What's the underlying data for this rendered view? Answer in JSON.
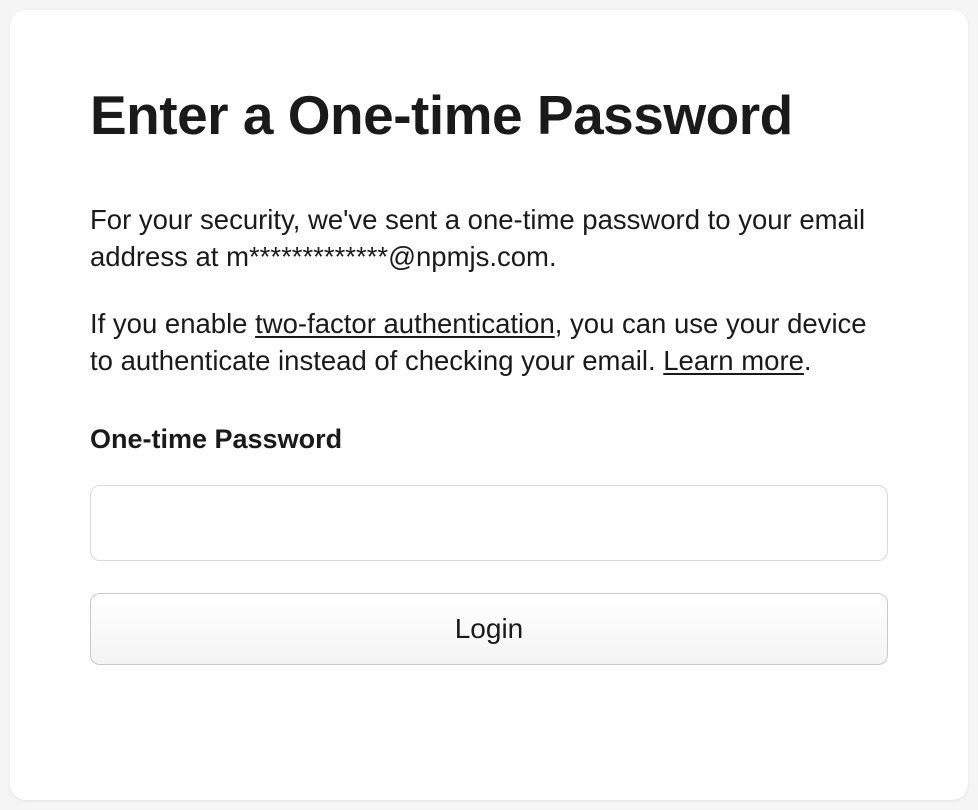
{
  "title": "Enter a One-time Password",
  "paragraph1": {
    "prefix": "For your security, we've sent a one-time password to your email address at ",
    "email": "m*************@npmjs.com",
    "suffix": "."
  },
  "paragraph2": {
    "t1": "If you enable ",
    "link1": "two-factor authentication",
    "t2": ", you can use your device to authenticate instead of checking your email. ",
    "link2": "Learn more",
    "t3": "."
  },
  "form": {
    "label": "One-time Password",
    "value": "",
    "submit": "Login"
  }
}
